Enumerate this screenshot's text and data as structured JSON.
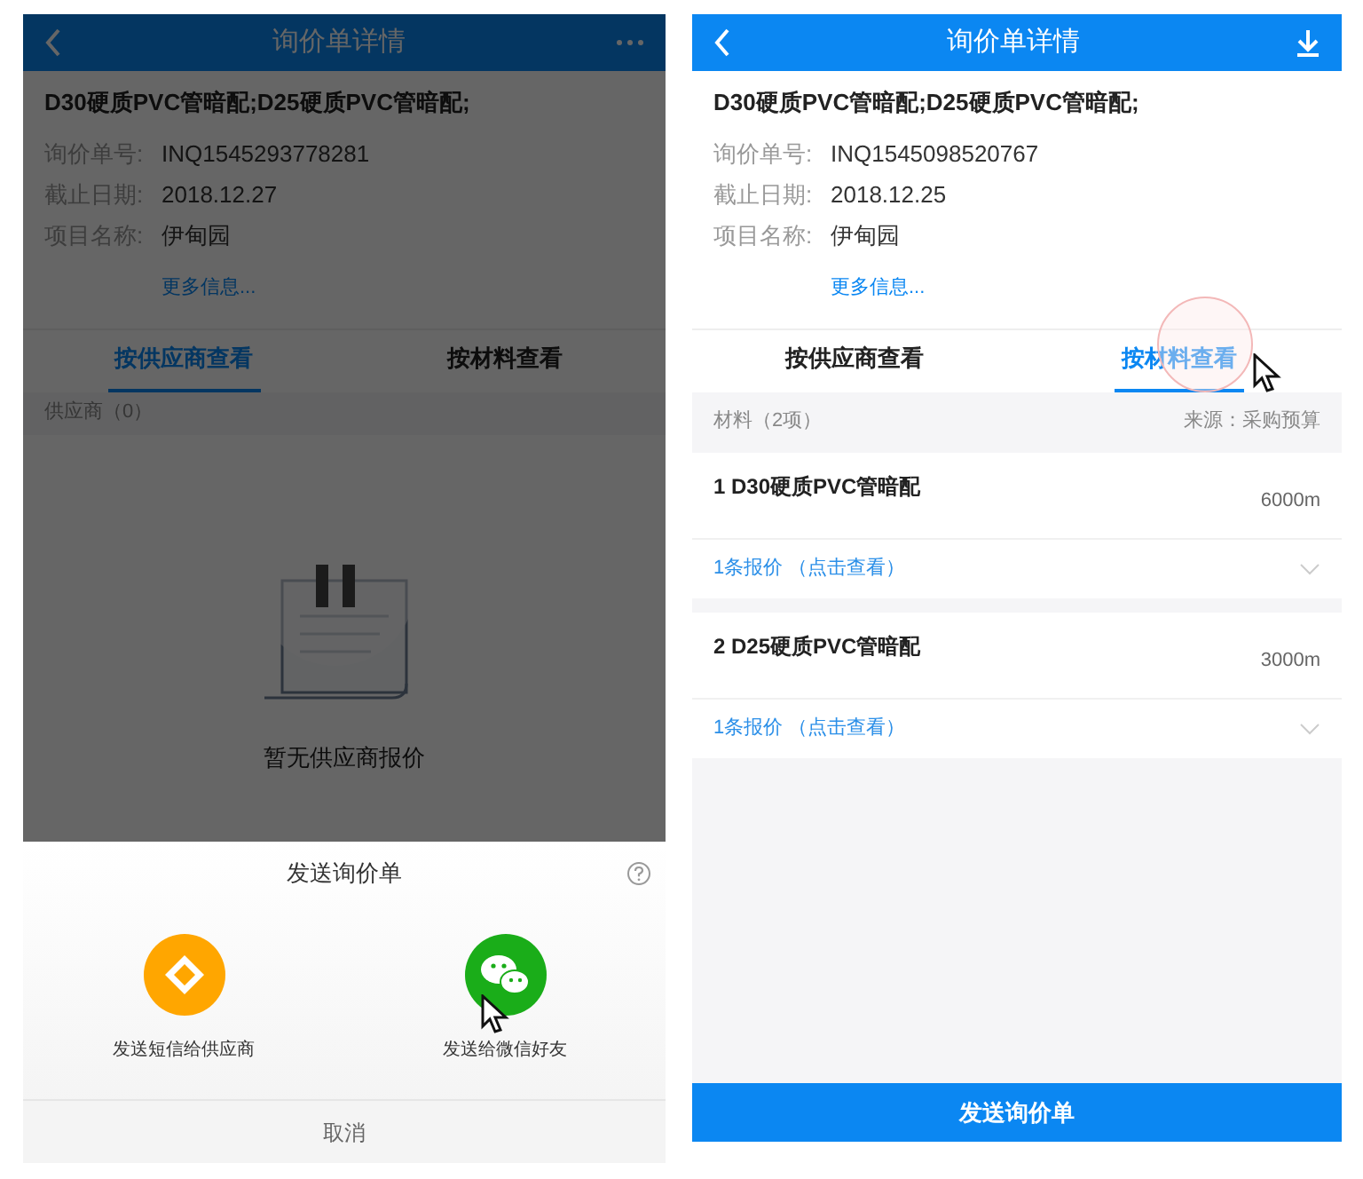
{
  "screens": [
    {
      "dimmed": true,
      "header": {
        "title": "询价单详情",
        "kind": "more"
      },
      "summary": {
        "title": "D30硬质PVC管暗配;D25硬质PVC管暗配;",
        "fields": [
          {
            "label": "询价单号:",
            "value": "INQ1545293778281"
          },
          {
            "label": "截止日期:",
            "value": "2018.12.27"
          },
          {
            "label": "项目名称:",
            "value": "伊甸园"
          }
        ],
        "more_link": "更多信息..."
      },
      "tabs": [
        {
          "label": "按供应商查看",
          "selected": true
        },
        {
          "label": "按材料查看",
          "selected": false
        }
      ],
      "list_header": {
        "left": "供应商（0）"
      },
      "empty_text": "暂无供应商报价",
      "sheet": {
        "title": "发送询价单",
        "options": [
          {
            "kind": "sms",
            "label": "发送短信给供应商"
          },
          {
            "kind": "wechat",
            "label": "发送给微信好友"
          }
        ],
        "cancel": "取消"
      }
    },
    {
      "dimmed": false,
      "header": {
        "title": "询价单详情",
        "kind": "download"
      },
      "summary": {
        "title": "D30硬质PVC管暗配;D25硬质PVC管暗配;",
        "fields": [
          {
            "label": "询价单号:",
            "value": "INQ1545098520767"
          },
          {
            "label": "截止日期:",
            "value": "2018.12.25"
          },
          {
            "label": "项目名称:",
            "value": "伊甸园"
          }
        ],
        "more_link": "更多信息..."
      },
      "tabs": [
        {
          "label": "按供应商查看",
          "selected": false
        },
        {
          "label": "按材料查看",
          "selected": true
        }
      ],
      "list_header": {
        "left": "材料（2项）",
        "right": "来源：采购预算"
      },
      "items": [
        {
          "name": "1 D30硬质PVC管暗配",
          "quantity": "6000m",
          "quotes": "1条报价 （点击查看）"
        },
        {
          "name": "2 D25硬质PVC管暗配",
          "quantity": "3000m",
          "quotes": "1条报价 （点击查看）"
        }
      ],
      "bottom_button": "发送询价单"
    }
  ]
}
